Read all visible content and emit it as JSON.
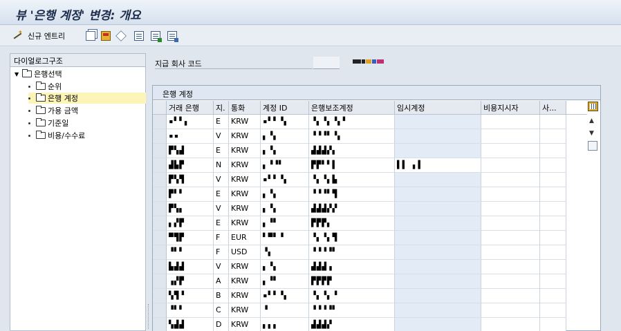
{
  "title": "뷰 '은행 계정' 변경: 개요",
  "toolbar": {
    "new_entries_label": "신규 엔트리",
    "icons": [
      "wand-icon",
      "copy-icon",
      "save-icon",
      "undo-icon",
      "doc-icon",
      "doc-export-icon",
      "doc-import-icon"
    ]
  },
  "dialog_structure": {
    "heading": "다이얼로그구조",
    "root": "은행선택",
    "items": [
      "순위",
      "은행 계정",
      "가용 금액",
      "기준일",
      "비용/수수료"
    ],
    "selected": "은행 계정"
  },
  "field": {
    "label": "지급 회사 코드",
    "value": ""
  },
  "table": {
    "title": "은행 계정",
    "columns": [
      "거래 은행",
      "지.",
      "통화",
      "계정 ID",
      "은행보조계정",
      "임시계정",
      "비용지시자",
      "사..."
    ],
    "rows": [
      {
        "bank": "▪▘▘▖",
        "method": "E",
        "currency": "KRW",
        "acct_id": "▪▘▘▝▖",
        "sub": "▝▖▝▖▝▖▘",
        "temp": "",
        "cost": "",
        "extra": ""
      },
      {
        "bank": "▪▪",
        "method": "V",
        "currency": "KRW",
        "acct_id": "▖▝▖",
        "sub": "▝▝▝▘▝▖",
        "temp": "",
        "cost": "",
        "extra": ""
      },
      {
        "bank": "▛▚▟",
        "method": "E",
        "currency": "KRW",
        "acct_id": "▖▝▖",
        "sub": "▟▟▟▞▖",
        "temp": "",
        "cost": "",
        "extra": ""
      },
      {
        "bank": "▟▙▛",
        "method": "N",
        "currency": "KRW",
        "acct_id": "▖▝▝▘",
        "sub": "▛▛▘▘▌",
        "temp": "▌▌ ▖▌",
        "cost": "",
        "extra": ""
      },
      {
        "bank": "▛▚▜",
        "method": "V",
        "currency": "KRW",
        "acct_id": "▪▘▘▝▖",
        "sub": "▝▖▝▖▙",
        "temp": "",
        "cost": "",
        "extra": ""
      },
      {
        "bank": "▛▘▘",
        "method": "E",
        "currency": "KRW",
        "acct_id": "▖▝▖",
        "sub": "▝▝▝▘▜",
        "temp": "",
        "cost": "",
        "extra": ""
      },
      {
        "bank": "▛▚▖",
        "method": "V",
        "currency": "KRW",
        "acct_id": "▖▝▖",
        "sub": "▟▟▟▞▞",
        "temp": "",
        "cost": "",
        "extra": ""
      },
      {
        "bank": "▖▞▛",
        "method": "E",
        "currency": "KRW",
        "acct_id": "▖▝▘",
        "sub": "▛▛▛▖",
        "temp": "",
        "cost": "",
        "extra": ""
      },
      {
        "bank": "▀▜▛",
        "method": "F",
        "currency": "EUR",
        "acct_id": "▘▀▘▝",
        "sub": "▝▖▝▖▜",
        "temp": "",
        "cost": "",
        "extra": ""
      },
      {
        "bank": "▝▘▘",
        "method": "F",
        "currency": "USD",
        "acct_id": "▝▖",
        "sub": "▝▝▝▝▘",
        "temp": "",
        "cost": "",
        "extra": ""
      },
      {
        "bank": "▙▟▟",
        "method": "V",
        "currency": "KRW",
        "acct_id": "▖▝▖",
        "sub": "▟▟▟▗",
        "temp": "",
        "cost": "",
        "extra": ""
      },
      {
        "bank": "▗▞▛",
        "method": "A",
        "currency": "KRW",
        "acct_id": "▖▝▘",
        "sub": "▛▛▛▛",
        "temp": "",
        "cost": "",
        "extra": ""
      },
      {
        "bank": "▚▜▝",
        "method": "B",
        "currency": "KRW",
        "acct_id": "▪▘▘▝▖",
        "sub": "▝▖▝▖▝",
        "temp": "",
        "cost": "",
        "extra": ""
      },
      {
        "bank": "▝▘▘",
        "method": "C",
        "currency": "KRW",
        "acct_id": "▝",
        "sub": "▝▝▝▝▘",
        "temp": "",
        "cost": "",
        "extra": ""
      },
      {
        "bank": "▚▟▟",
        "method": "D",
        "currency": "KRW",
        "acct_id": "▖▖▖",
        "sub": "▟▟▟▞",
        "temp": "",
        "cost": "",
        "extra": ""
      }
    ]
  },
  "colors": {
    "title_text": "#1c2c4a",
    "selected_tree_bg": "#fdf5b8",
    "temp_col_bg": "#e3ecf6",
    "header_bg": "#e5eaf0"
  }
}
